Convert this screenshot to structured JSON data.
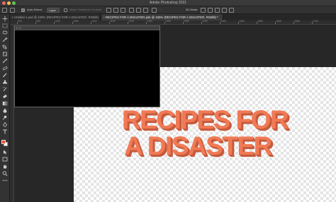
{
  "window": {
    "title": "Adobe Photoshop 2021"
  },
  "options_bar": {
    "auto_select_label": "Auto-Select:",
    "layer_select_value": "Layer",
    "show_transform_label": "Show Transform Controls",
    "mode_3d_label": "3D Mode:"
  },
  "tabs": [
    {
      "label": "Untitled-1.psd @ 100% (RECIPES FOR A DISASTER, RGB/8)",
      "active": false
    },
    {
      "label": "RECIPES FOR A DISASTER.psb @ 100% (RECIPES FOR A DISASTER, RGB/8) *",
      "active": true
    }
  ],
  "rulers": {
    "top_numbers": [
      "900",
      "950",
      "1000",
      "1050",
      "1100",
      "1150",
      "1200",
      "1250",
      "1300",
      "1350",
      "1400",
      "1450",
      "1500",
      "1550",
      "1600",
      "1650",
      "1700"
    ]
  },
  "canvas": {
    "artwork": {
      "line1": "RECIPES FOR",
      "line2": "A DISASTER",
      "face_color": "#f07a55",
      "extrude_color": "#c65a3c"
    },
    "checker_colors": [
      "#ffffff",
      "#e4e4e4"
    ]
  },
  "toolbar": {
    "foreground_color": "#e1543e",
    "background_color": "#ffffff",
    "tools": [
      "move-tool-icon",
      "marquee-tool-icon",
      "lasso-tool-icon",
      "quick-select-tool-icon",
      "crop-tool-icon",
      "frame-tool-icon",
      "eyedropper-tool-icon",
      "healing-brush-tool-icon",
      "brush-tool-icon",
      "clone-stamp-tool-icon",
      "history-brush-tool-icon",
      "eraser-tool-icon",
      "gradient-tool-icon",
      "blur-tool-icon",
      "dodge-tool-icon",
      "pen-tool-icon",
      "type-tool-icon",
      "path-select-tool-icon",
      "rectangle-tool-icon",
      "hand-tool-icon",
      "zoom-tool-icon",
      "more-tools-icon"
    ]
  },
  "navigator": {
    "controls": "⇤ ✕"
  }
}
